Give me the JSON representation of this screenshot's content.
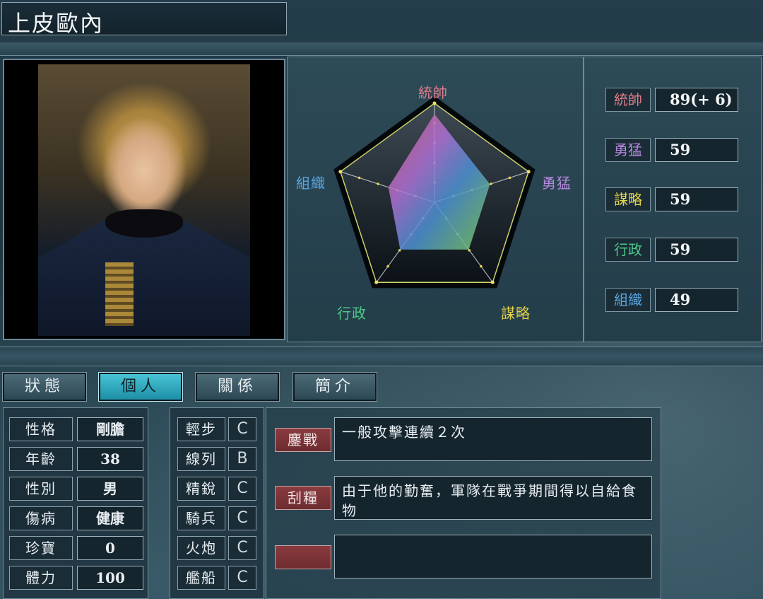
{
  "character": {
    "name": "上皮歐內"
  },
  "radar": {
    "labels": [
      {
        "text": "統帥",
        "color": "#e07c8a"
      },
      {
        "text": "勇猛",
        "color": "#b889e0"
      },
      {
        "text": "謀略",
        "color": "#e3d24a"
      },
      {
        "text": "行政",
        "color": "#4cc98a"
      },
      {
        "text": "組織",
        "color": "#5aa6e0"
      }
    ],
    "values": [
      89,
      59,
      59,
      59,
      49
    ],
    "max": 100
  },
  "stats": [
    {
      "label": "統帥",
      "value": "89(+ 6)",
      "color": "#e07c8a"
    },
    {
      "label": "勇猛",
      "value": "59",
      "color": "#b889e0"
    },
    {
      "label": "謀略",
      "value": "59",
      "color": "#e3d24a"
    },
    {
      "label": "行政",
      "value": "59",
      "color": "#4cc98a"
    },
    {
      "label": "組織",
      "value": "49",
      "color": "#5aa6e0"
    }
  ],
  "tabs": [
    {
      "label": "狀態",
      "active": false
    },
    {
      "label": "個人",
      "active": true
    },
    {
      "label": "關係",
      "active": false
    },
    {
      "label": "簡介",
      "active": false
    }
  ],
  "personal": [
    {
      "label": "性格",
      "value": "剛膽"
    },
    {
      "label": "年齡",
      "value": "38"
    },
    {
      "label": "性別",
      "value": "男"
    },
    {
      "label": "傷病",
      "value": "健康"
    },
    {
      "label": "珍寶",
      "value": "0"
    },
    {
      "label": "體力",
      "value": "100"
    }
  ],
  "skills": [
    {
      "label": "輕步",
      "grade": "C"
    },
    {
      "label": "線列",
      "grade": "B"
    },
    {
      "label": "精銳",
      "grade": "C"
    },
    {
      "label": "騎兵",
      "grade": "C"
    },
    {
      "label": "火炮",
      "grade": "C"
    },
    {
      "label": "艦船",
      "grade": "C"
    }
  ],
  "traits": [
    {
      "label": "鏖戰",
      "desc": "一般攻擊連續２次"
    },
    {
      "label": "刮糧",
      "desc": "由于他的勤奮，軍隊在戰爭期間得以自給食物"
    },
    {
      "label": "",
      "desc": ""
    }
  ]
}
